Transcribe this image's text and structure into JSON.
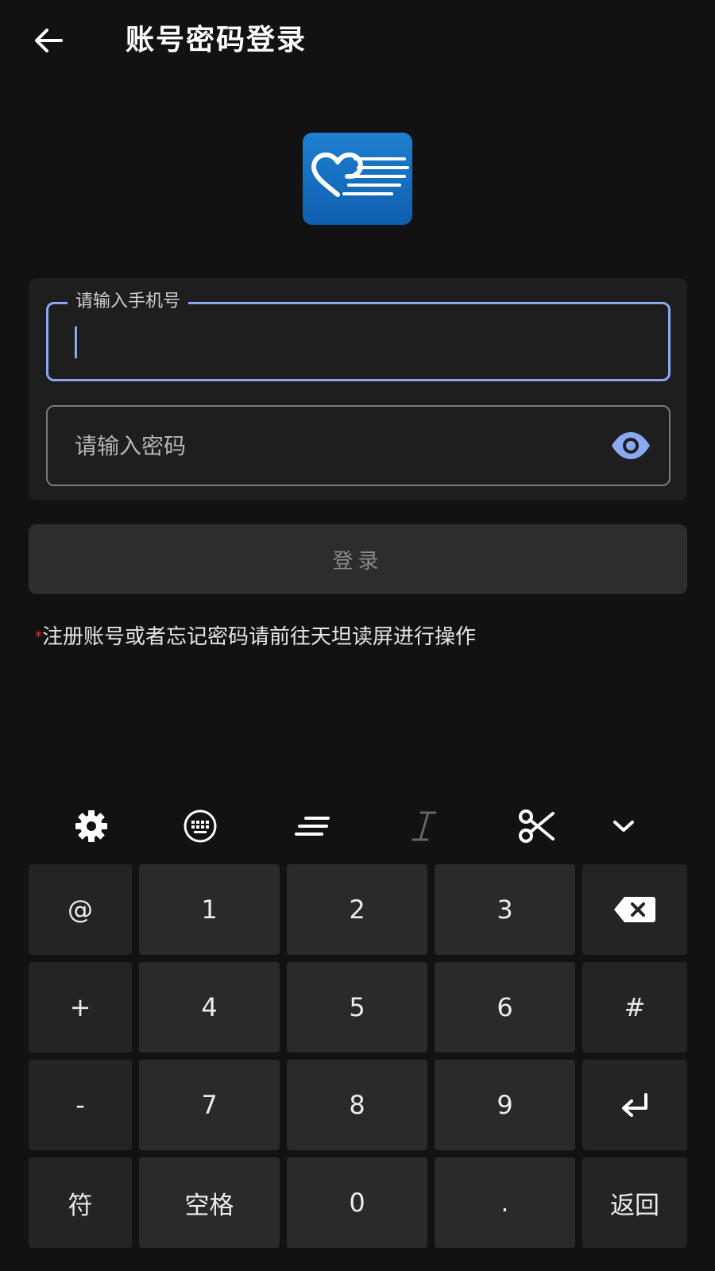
{
  "header": {
    "back_icon": "arrow-left-icon",
    "title": "账号密码登录"
  },
  "logo": {
    "icon": "heart-lines-logo",
    "color": "#1a73c7"
  },
  "form": {
    "phone": {
      "label": "请输入手机号",
      "value": "",
      "focused": true,
      "accent": "#8aa9f0"
    },
    "password": {
      "placeholder": "请输入密码",
      "value": "",
      "toggle_icon": "eye-icon"
    }
  },
  "login_button": {
    "label": "登录",
    "enabled": false
  },
  "notice": {
    "asterisk": "*",
    "text": "注册账号或者忘记密码请前往天坦读屏进行操作",
    "asterisk_color": "#e0312b"
  },
  "keyboard": {
    "toolbar": [
      {
        "icon": "gear-icon"
      },
      {
        "icon": "keyboard-icon"
      },
      {
        "icon": "text-lines-icon"
      },
      {
        "icon": "italic-cursor-icon"
      },
      {
        "icon": "scissors-icon"
      },
      {
        "icon": "chevron-down-icon"
      }
    ],
    "rows": [
      [
        "@",
        "1",
        "2",
        "3",
        "⌫"
      ],
      [
        "+",
        "4",
        "5",
        "6",
        "#"
      ],
      [
        "-",
        "7",
        "8",
        "9",
        "↵"
      ],
      [
        "符",
        "空格",
        "0",
        ".",
        "返回"
      ]
    ]
  }
}
